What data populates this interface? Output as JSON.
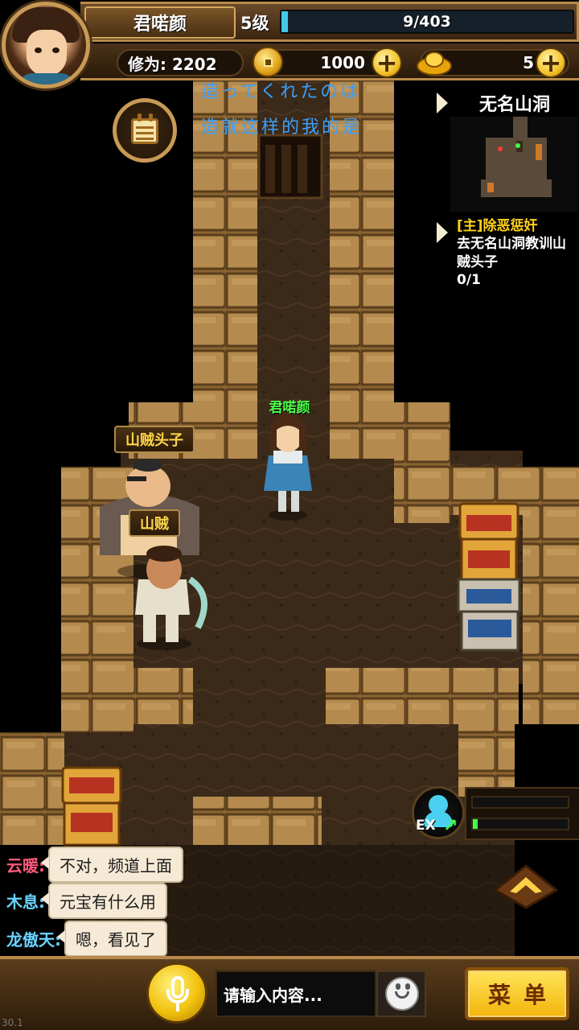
{
  "player": {
    "name": "君喏颜",
    "level": "5级",
    "exp": {
      "current": 9,
      "max": 403,
      "text": "9/403"
    },
    "cultivation": "修为: 2202"
  },
  "currency": {
    "copper": "1000",
    "gold": "5"
  },
  "lyrics": [
    "造ってくれたのは",
    "造就这样的我的是"
  ],
  "minimap": {
    "title": "无名山洞"
  },
  "quest": {
    "title": "[主]除恶惩奸",
    "desc": "去无名山洞教训山贼头子",
    "progress": "0/1"
  },
  "characters": {
    "player_label": "君喏颜",
    "boss_label": "山贼头子",
    "bandit_label": "山贼"
  },
  "chat": {
    "messages": [
      {
        "sender": "云暖:",
        "sender_color": "#ff5a7a",
        "text": "不对，频道上面"
      },
      {
        "sender": "木息:",
        "sender_color": "#6ad4ff",
        "text": "元宝有什么用"
      },
      {
        "sender": "龙傲天:",
        "sender_color": "#6ad4ff",
        "text": "嗯，看见了"
      }
    ],
    "input_placeholder": "请输入内容..."
  },
  "menu_label": "菜单",
  "fps": "30.1",
  "colors": {
    "exp_fill": "#43c9e6",
    "quest_title": "#ffd21a",
    "player_name": "#4cff4c",
    "lyric": "#3aa0ff"
  },
  "icons": [
    "coin-icon",
    "gold-ingot-icon",
    "plus-icon",
    "calendar-icon",
    "ex-icon",
    "mic-icon",
    "emoji-icon",
    "chevron-up-icon"
  ]
}
